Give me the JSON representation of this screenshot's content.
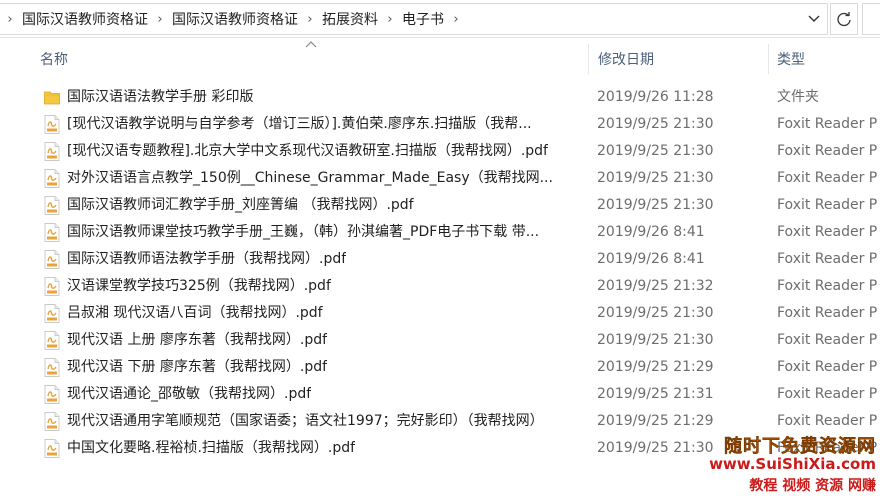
{
  "breadcrumbs": [
    "国际汉语教师资格证",
    "国际汉语教师资格证",
    "拓展资料",
    "电子书"
  ],
  "columns": {
    "name": "名称",
    "date": "修改日期",
    "type": "类型"
  },
  "files": [
    {
      "name": "国际汉语语法教学手册 彩印版",
      "date": "2019/9/26 11:28",
      "type": "文件夹",
      "icon": "folder-icon"
    },
    {
      "name": "[现代汉语教学说明与自学参考（增订三版）].黄伯荣.廖序东.扫描版（我帮...",
      "date": "2019/9/25 21:30",
      "type": "Foxit Reader P",
      "icon": "pdf-icon"
    },
    {
      "name": "[现代汉语专题教程].北京大学中文系现代汉语教研室.扫描版（我帮找网）.pdf",
      "date": "2019/9/25 21:30",
      "type": "Foxit Reader P",
      "icon": "pdf-icon"
    },
    {
      "name": "对外汉语语言点教学_150例__Chinese_Grammar_Made_Easy（我帮找网...",
      "date": "2019/9/25 21:30",
      "type": "Foxit Reader P",
      "icon": "pdf-icon"
    },
    {
      "name": "国际汉语教师词汇教学手册_刘座箐编 （我帮找网）.pdf",
      "date": "2019/9/25 21:30",
      "type": "Foxit Reader P",
      "icon": "pdf-icon"
    },
    {
      "name": "国际汉语教师课堂技巧教学手册_王巍，（韩）孙淇编著_PDF电子书下载 带...",
      "date": "2019/9/26 8:41",
      "type": "Foxit Reader P",
      "icon": "pdf-icon"
    },
    {
      "name": "国际汉语教师语法教学手册（我帮找网）.pdf",
      "date": "2019/9/26 8:41",
      "type": "Foxit Reader P",
      "icon": "pdf-icon"
    },
    {
      "name": "汉语课堂教学技巧325例（我帮找网）.pdf",
      "date": "2019/9/25 21:32",
      "type": "Foxit Reader P",
      "icon": "pdf-icon"
    },
    {
      "name": "吕叔湘 现代汉语八百词（我帮找网）.pdf",
      "date": "2019/9/25 21:30",
      "type": "Foxit Reader P",
      "icon": "pdf-icon"
    },
    {
      "name": "现代汉语 上册 廖序东著（我帮找网）.pdf",
      "date": "2019/9/25 21:30",
      "type": "Foxit Reader P",
      "icon": "pdf-icon"
    },
    {
      "name": "现代汉语 下册 廖序东著（我帮找网）.pdf",
      "date": "2019/9/25 21:29",
      "type": "Foxit Reader P",
      "icon": "pdf-icon"
    },
    {
      "name": "现代汉语通论_邵敬敏（我帮找网）.pdf",
      "date": "2019/9/25 21:31",
      "type": "Foxit Reader P",
      "icon": "pdf-icon"
    },
    {
      "name": "现代汉语通用字笔顺规范（国家语委；语文社1997；完好影印）（我帮找网）",
      "date": "2019/9/25 21:29",
      "type": "Foxit Reader P",
      "icon": "pdf-icon"
    },
    {
      "name": "中国文化要略.程裕桢.扫描版（我帮找网）.pdf",
      "date": "2019/9/25 21:30",
      "type": "Foxit Reader P",
      "icon": "pdf-icon"
    }
  ],
  "watermark": {
    "line1": "随时下免费资源网",
    "line2": "www.SuiShiXia.com",
    "line3": "教程 视频 资源 网赚"
  },
  "colors": {
    "folder": "#f5c842",
    "pdf_accent": "#e8a33d",
    "header_text": "#4c607a",
    "watermark_orange": "#f07b10",
    "watermark_red": "#cc1a1a"
  }
}
